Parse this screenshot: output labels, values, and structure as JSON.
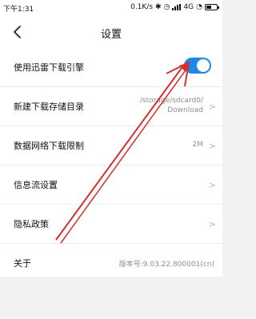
{
  "status_bar": {
    "time": "下午1:31",
    "network_speed": "0.1K/s",
    "network_type": "4G",
    "icons": [
      "bluetooth-icon",
      "alarm-icon",
      "wifi-icon",
      "signal-icon",
      "battery-icon"
    ]
  },
  "header": {
    "title": "设置",
    "back_icon": "chevron-left-icon"
  },
  "settings": {
    "items": [
      {
        "label": "使用迅雷下载引擎",
        "type": "toggle",
        "toggle_on": true
      },
      {
        "label": "新建下载存储目录",
        "value_line1": "/storage/sdcard0/",
        "value_line2": "Download"
      },
      {
        "label": "数据网络下载限制",
        "value": "2M"
      },
      {
        "label": "信息流设置"
      },
      {
        "label": "隐私政策"
      },
      {
        "label": "关于",
        "value": "版本号:9.03.22.800001(cn)"
      }
    ]
  },
  "colors": {
    "accent": "#1e88e5",
    "annotation_arrow": "#d32f2f"
  }
}
